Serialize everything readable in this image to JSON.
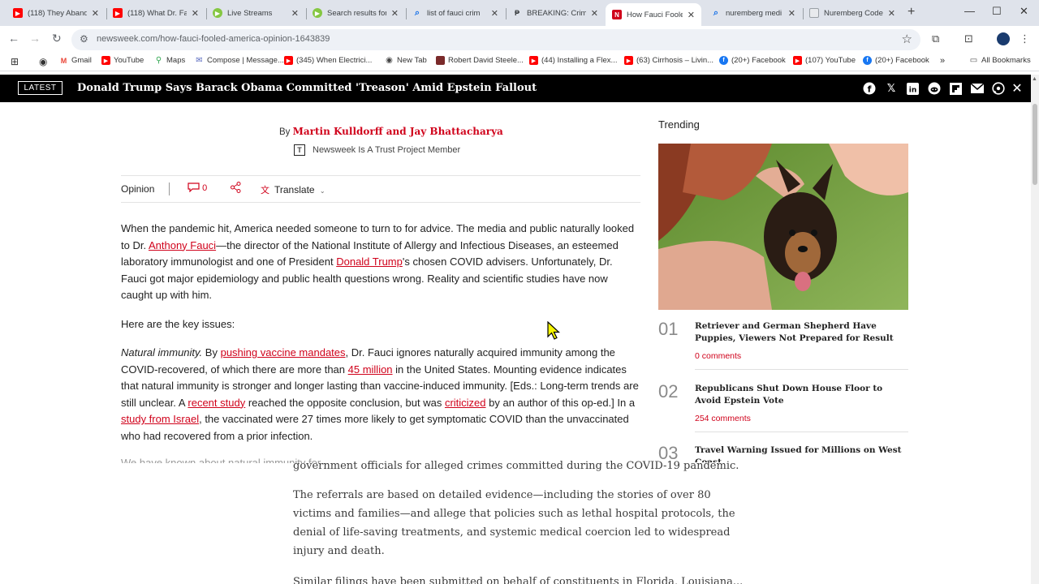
{
  "browser": {
    "tabs": [
      {
        "title": "(118) They Aband",
        "icon": "youtube-icon",
        "color": "#ff0000"
      },
      {
        "title": "(118) What Dr. Fa",
        "icon": "youtube-icon",
        "color": "#ff0000"
      },
      {
        "title": "Live Streams",
        "icon": "rumble-icon",
        "color": "#85c742"
      },
      {
        "title": "Search results for",
        "icon": "rumble-icon",
        "color": "#85c742"
      },
      {
        "title": "list of fauci crim",
        "icon": "search-icon",
        "color": "#1a73e8"
      },
      {
        "title": "BREAKING: Crim",
        "icon": "page-icon",
        "color": "#3c4043"
      },
      {
        "title": "How Fauci Foole",
        "icon": "newsweek-icon",
        "color": "#d0021b"
      },
      {
        "title": "nuremberg medi",
        "icon": "search-icon",
        "color": "#1a73e8"
      },
      {
        "title": "Nuremberg Code",
        "icon": "doc-icon",
        "color": "#9aa0a6"
      }
    ],
    "url": "newsweek.com/how-fauci-fooled-america-opinion-1643839",
    "bookmarks": [
      {
        "label": "Gmail",
        "icon": "gmail-icon",
        "color": "#ea4335"
      },
      {
        "label": "YouTube",
        "icon": "youtube-icon",
        "color": "#ff0000"
      },
      {
        "label": "Maps",
        "icon": "maps-icon",
        "color": "#34a853"
      },
      {
        "label": "Compose | Message...",
        "icon": "compose-icon",
        "color": "#5b6cc0"
      },
      {
        "label": "(345) When Electrici...",
        "icon": "youtube-icon",
        "color": "#ff0000"
      },
      {
        "label": "New Tab",
        "icon": "globe-icon",
        "color": "#444444"
      },
      {
        "label": "Robert David Steele...",
        "icon": "bookmark-icon",
        "color": "#7a2a2a"
      },
      {
        "label": "(44) Installing a Flex...",
        "icon": "youtube-icon",
        "color": "#ff0000"
      },
      {
        "label": "(63) Cirrhosis – Livin...",
        "icon": "youtube-icon",
        "color": "#ff0000"
      },
      {
        "label": "(20+) Facebook",
        "icon": "facebook-icon",
        "color": "#1877f2"
      },
      {
        "label": "(107) YouTube",
        "icon": "youtube-icon",
        "color": "#ff0000"
      },
      {
        "label": "(20+) Facebook",
        "icon": "facebook-icon",
        "color": "#1877f2"
      }
    ],
    "all_bookmarks": "All Bookmarks"
  },
  "banner": {
    "badge": "LATEST",
    "headline": "Donald Trump Says Barack Obama Committed 'Treason' Amid Epstein Fallout"
  },
  "article": {
    "by": "By",
    "authors": "Martin Kulldorff and Jay Bhattacharya",
    "trust": "Newsweek Is A Trust Project Member",
    "section": "Opinion",
    "comment_count": "0",
    "translate": "Translate",
    "p1": {
      "a": "When the pandemic hit, America needed someone to turn to for advice. The media and public naturally looked to Dr. ",
      "link1": "Anthony Fauci",
      "b": "—the director of the National Institute of Allergy and Infectious Diseases, an esteemed laboratory immunologist and one of President ",
      "link2": "Donald Trump",
      "c": "'s chosen COVID advisers. Unfortunately, Dr. Fauci got major epidemiology and public health questions wrong. Reality and scientific studies have now caught up with him."
    },
    "p2": "Here are the key issues:",
    "p3": {
      "italic": "Natural immunity.",
      "a": " By ",
      "link1": "pushing vaccine mandates",
      "b": ", Dr. Fauci ignores naturally acquired immunity among the COVID-recovered, of which there are more than ",
      "link2": "45 million",
      "c": " in the United States. Mounting evidence indicates that natural immunity is stronger and longer lasting than vaccine-induced immunity. [Eds.: Long-term trends are still unclear. A ",
      "link3": "recent study",
      "d": " reached the opposite conclusion, but was ",
      "link4": "criticized",
      "e": " by an author of this op-ed.] In a ",
      "link5": "study from Israel",
      "f": ", the vaccinated were 27 times more likely to get symptomatic COVID than the unvaccinated who had recovered from a prior infection."
    },
    "p4_partial": "We have known about natural immunity for..."
  },
  "trending": {
    "title": "Trending",
    "items": [
      {
        "num": "01",
        "title": "Retriever and German Shepherd Have Puppies, Viewers Not Prepared for Result",
        "comments": "0 comments"
      },
      {
        "num": "02",
        "title": "Republicans Shut Down House Floor to Avoid Epstein Vote",
        "comments": "254 comments"
      },
      {
        "num": "03",
        "title": "Travel Warning Issued for Millions on West Coast",
        "comments": ""
      }
    ]
  },
  "overlay": {
    "line0": "government officials for alleged crimes committed during the COVID-19 pandemic.",
    "p1": "The referrals are based on detailed evidence—including the stories of over 80 victims and families—and allege that policies such as lethal hospital protocols, the denial of life-saving treatments, and systemic medical coercion led to widespread injury and death.",
    "p2": "Similar filings have been submitted on behalf of constituents in Florida, Louisiana..."
  }
}
